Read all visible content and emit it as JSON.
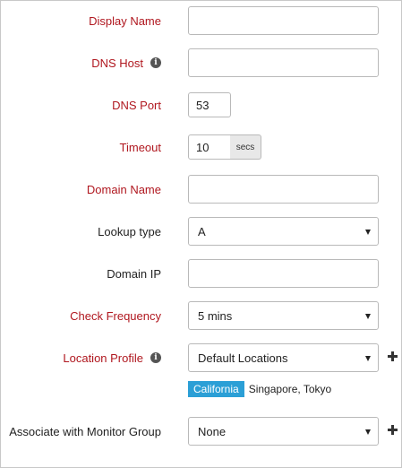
{
  "form": {
    "display_name": {
      "label": "Display Name",
      "value": ""
    },
    "dns_host": {
      "label": "DNS Host",
      "value": ""
    },
    "dns_port": {
      "label": "DNS Port",
      "value": "53"
    },
    "timeout": {
      "label": "Timeout",
      "value": "10",
      "unit": "secs"
    },
    "domain_name": {
      "label": "Domain Name",
      "value": ""
    },
    "lookup_type": {
      "label": "Lookup type",
      "value": "A"
    },
    "domain_ip": {
      "label": "Domain IP",
      "value": ""
    },
    "check_frequency": {
      "label": "Check Frequency",
      "value": "5 mins"
    },
    "location_profile": {
      "label": "Location Profile",
      "value": "Default Locations",
      "primary_location": "California",
      "other_locations": "Singapore, Tokyo"
    },
    "monitor_group": {
      "label": "Associate with Monitor Group",
      "value": "None"
    }
  },
  "icons": {
    "info": "i",
    "required_color": "#b0171f",
    "tag_color": "#2b9fd6"
  }
}
